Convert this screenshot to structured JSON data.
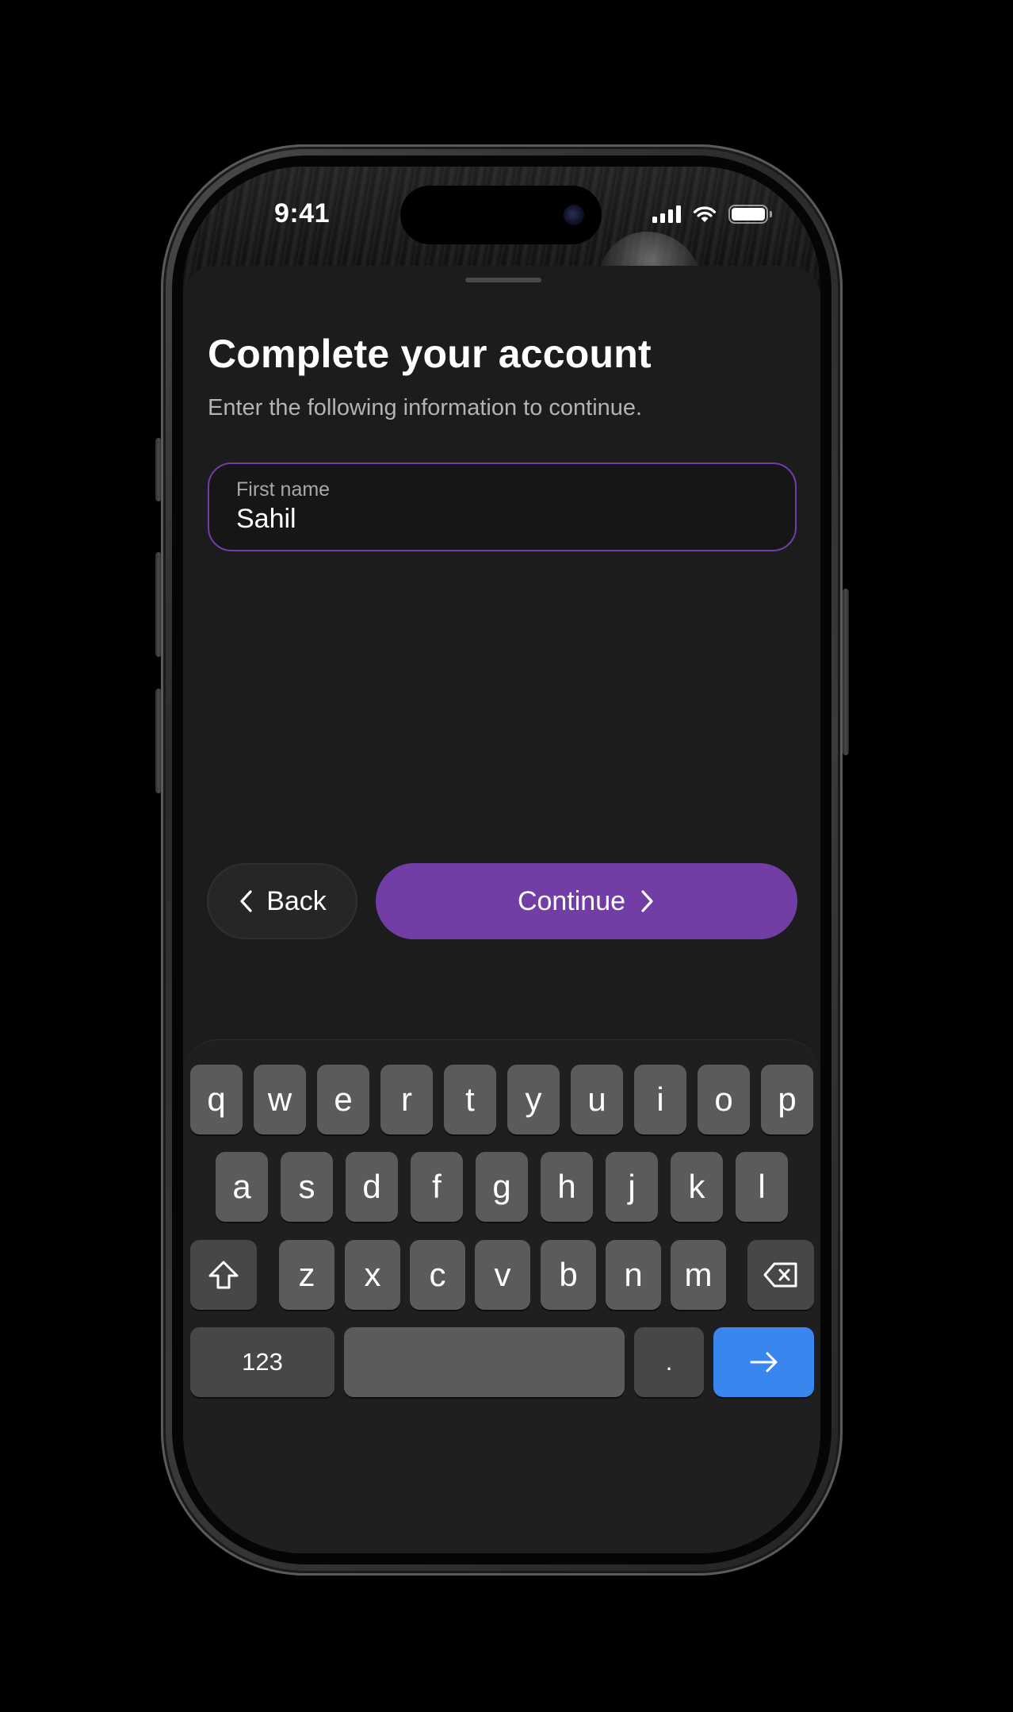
{
  "status_bar": {
    "time": "9:41",
    "icons": [
      "cellular-signal-icon",
      "wifi-icon",
      "battery-icon"
    ]
  },
  "sheet": {
    "title": "Complete your account",
    "subtitle": "Enter the following information to continue."
  },
  "form": {
    "first_name": {
      "label": "First name",
      "value": "Sahil"
    }
  },
  "actions": {
    "back_label": "Back",
    "continue_label": "Continue"
  },
  "keyboard": {
    "row1": [
      "q",
      "w",
      "e",
      "r",
      "t",
      "y",
      "u",
      "i",
      "o",
      "p"
    ],
    "row2": [
      "a",
      "s",
      "d",
      "f",
      "g",
      "h",
      "j",
      "k",
      "l"
    ],
    "row3": [
      "z",
      "x",
      "c",
      "v",
      "b",
      "n",
      "m"
    ],
    "numbers_key": "123",
    "period_key": ".",
    "icons": [
      "shift-icon",
      "delete-icon",
      "go-arrow-icon"
    ]
  },
  "colors": {
    "accent": "#723EA6",
    "field_border": "#6E3FA8",
    "keyboard_return": "#3A86EF",
    "sheet_background": "#1C1C1D"
  }
}
